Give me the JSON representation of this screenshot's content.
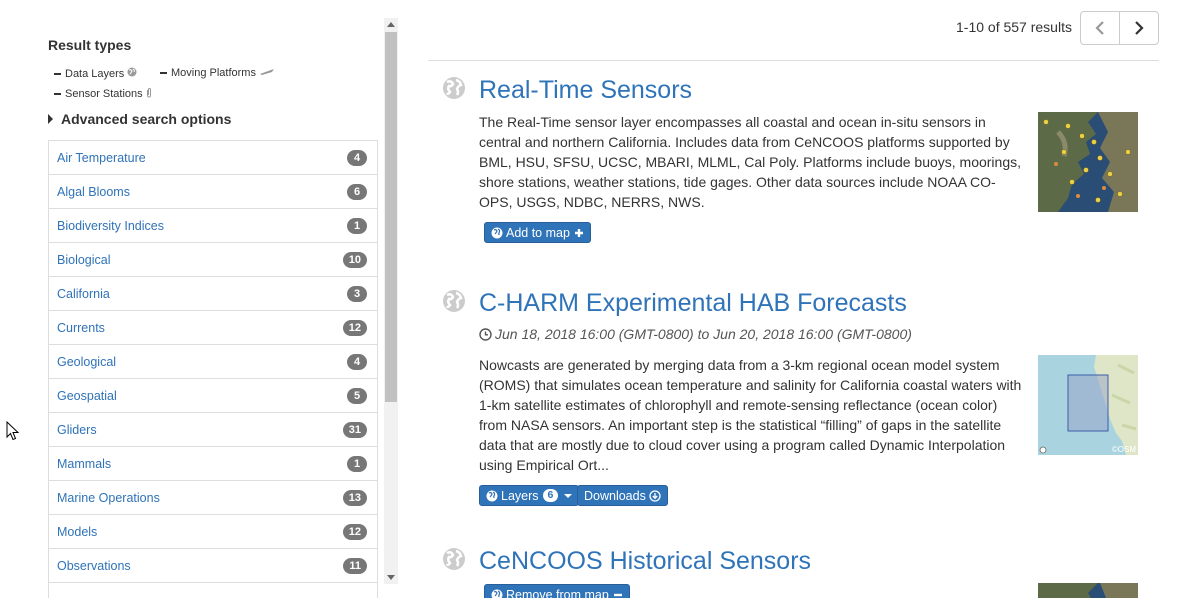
{
  "sidebar": {
    "result_types_title": "Result types",
    "result_types": [
      {
        "label": "Data Layers",
        "icon": "globe-icon"
      },
      {
        "label": "Moving Platforms",
        "icon": "glider-icon"
      },
      {
        "label": "Sensor Stations",
        "icon": "paperclip-icon"
      }
    ],
    "advanced_label": "Advanced search options",
    "facets": [
      {
        "label": "Air Temperature",
        "count": "4"
      },
      {
        "label": "Algal Blooms",
        "count": "6"
      },
      {
        "label": "Biodiversity Indices",
        "count": "1"
      },
      {
        "label": "Biological",
        "count": "10"
      },
      {
        "label": "California",
        "count": "3"
      },
      {
        "label": "Currents",
        "count": "12"
      },
      {
        "label": "Geological",
        "count": "4"
      },
      {
        "label": "Geospatial",
        "count": "5"
      },
      {
        "label": "Gliders",
        "count": "31"
      },
      {
        "label": "Mammals",
        "count": "1"
      },
      {
        "label": "Marine Operations",
        "count": "13"
      },
      {
        "label": "Models",
        "count": "12"
      },
      {
        "label": "Observations",
        "count": "11"
      },
      {
        "label": "",
        "count": ""
      }
    ]
  },
  "header": {
    "results_count": "1-10 of 557 results"
  },
  "results": [
    {
      "title": "Real-Time Sensors",
      "description": "The Real-Time sensor layer encompasses all coastal and ocean in-situ sensors in central and northern California. Includes data from CeNCOOS platforms supported by BML, HSU, SFSU, UCSC, MBARI, MLML, Cal Poly. Platforms include buoys, moorings, shore stations, weather stations, tide gages. Other data sources include NOAA CO-OPS, USGS, NDBC, NERRS, NWS.",
      "add_label": "Add to map"
    },
    {
      "title": "C-HARM Experimental HAB Forecasts",
      "dates": "Jun 18, 2018 16:00 (GMT-0800) to Jun 20, 2018 16:00 (GMT-0800)",
      "description": "Nowcasts are generated by merging data from a 3-km regional ocean model system (ROMS) that simulates ocean temperature and salinity for California coastal waters with 1-km satellite estimates of chlorophyll and remote-sensing reflectance (ocean color) from NASA sensors. An important step is the statistical “filling” of gaps in the satellite data that are mostly due to cloud cover using a program called Dynamic Interpolation using Empirical Ort...",
      "layers_label": "Layers",
      "layers_count": "6",
      "downloads_label": "Downloads",
      "map_credit": "©OSM"
    },
    {
      "title": "CeNCOOS Historical Sensors",
      "remove_label": "Remove from map"
    }
  ],
  "colors": {
    "link": "#2f73b8",
    "badge": "#777777",
    "button": "#2f73b8"
  }
}
